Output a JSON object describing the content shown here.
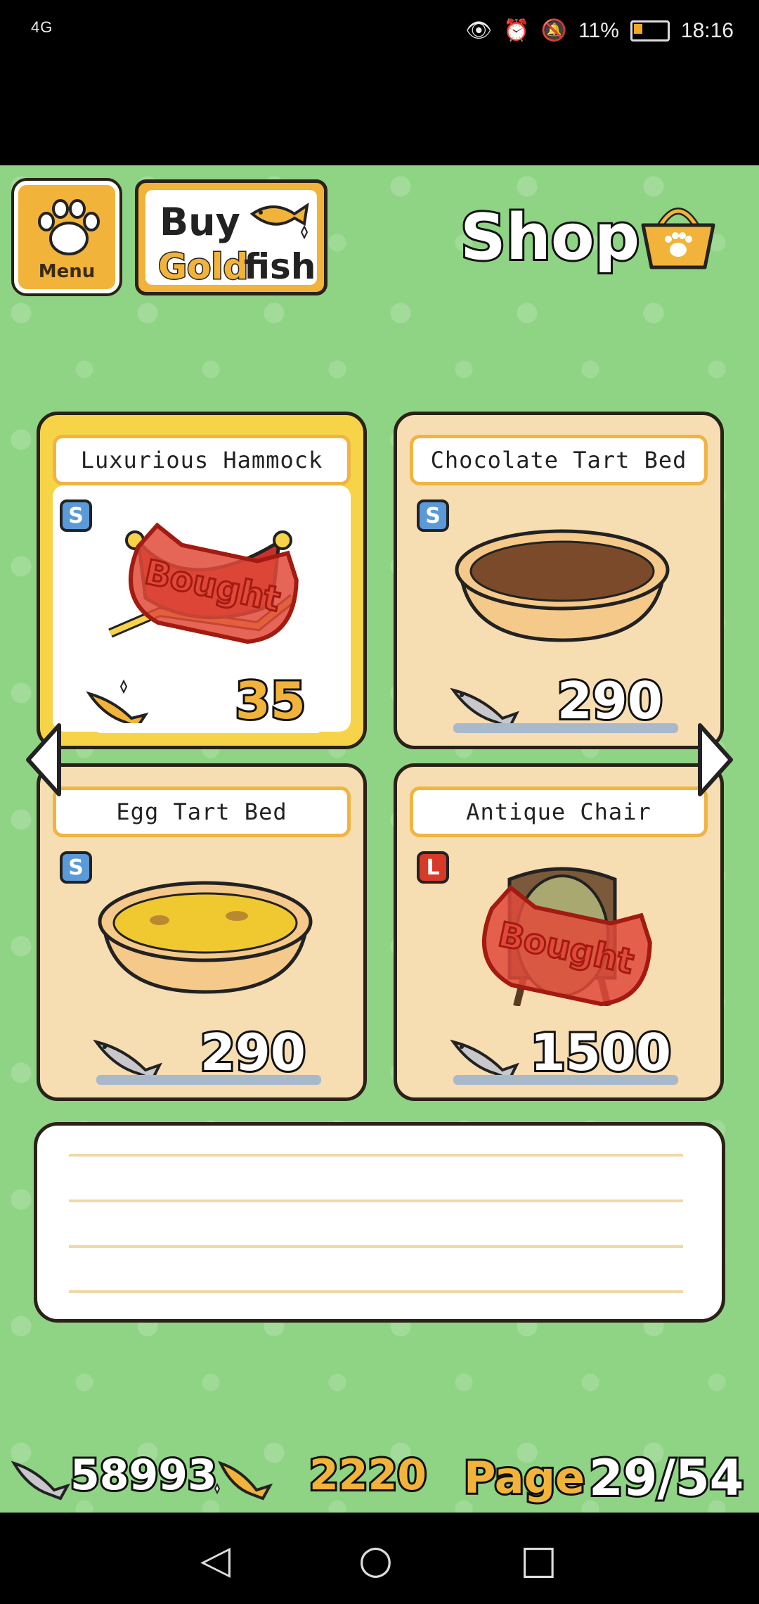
{
  "status_bar": {
    "signal": "4G",
    "battery": "11%",
    "time": "18:16"
  },
  "header": {
    "menu_label": "Menu",
    "goldfish_button": {
      "buy": "Buy",
      "gold": "Gold",
      "fish": "fish"
    },
    "title": "Shop"
  },
  "items": [
    {
      "name": "Luxurious Hammock",
      "size": "S",
      "currency": "gold-fish",
      "price": "35",
      "bought": true,
      "bought_label": "Bought",
      "selected": true
    },
    {
      "name": "Chocolate Tart Bed",
      "size": "S",
      "currency": "silver-fish",
      "price": "290",
      "bought": false,
      "selected": false
    },
    {
      "name": "Egg Tart Bed",
      "size": "S",
      "currency": "silver-fish",
      "price": "290",
      "bought": false,
      "selected": false
    },
    {
      "name": "Antique Chair",
      "size": "L",
      "currency": "silver-fish",
      "price": "1500",
      "bought": true,
      "bought_label": "Bought",
      "selected": false
    }
  ],
  "footer": {
    "silver_fish": "58993",
    "gold_fish": "2220",
    "page_label": "Page",
    "page": "29/54"
  },
  "colors": {
    "background": "#8fd385",
    "card": "#f7ddb2",
    "selected_card": "#f7d348",
    "gold": "#f2b33a",
    "bought_red": "#e04a3a"
  }
}
